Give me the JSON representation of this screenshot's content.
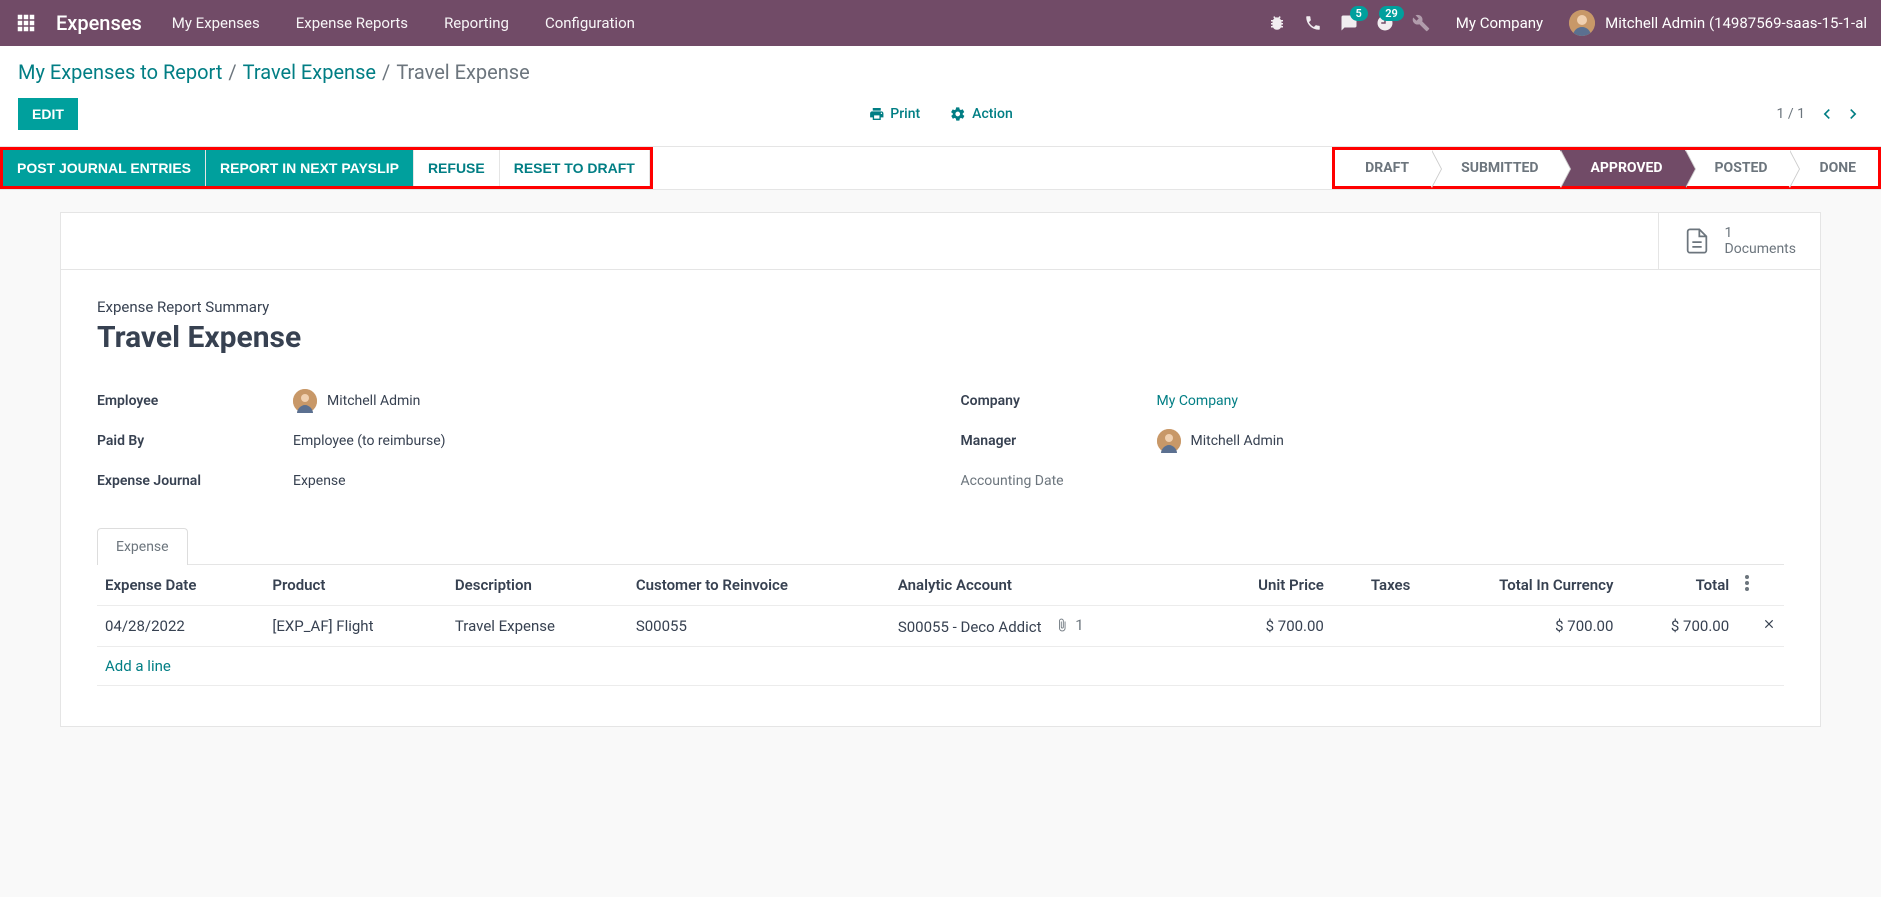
{
  "navbar": {
    "title": "Expenses",
    "menu": [
      "My Expenses",
      "Expense Reports",
      "Reporting",
      "Configuration"
    ],
    "messaging_badge": "5",
    "activities_badge": "29",
    "company": "My Company",
    "user": "Mitchell Admin (14987569-saas-15-1-al"
  },
  "breadcrumb": {
    "items": [
      "My Expenses to Report",
      "Travel Expense"
    ],
    "current": "Travel Expense"
  },
  "toolbar": {
    "edit": "EDIT",
    "print": "Print",
    "action": "Action",
    "pager": "1 / 1"
  },
  "statusbar": {
    "buttons": {
      "post_journal": "POST JOURNAL ENTRIES",
      "report_next_payslip": "REPORT IN NEXT PAYSLIP",
      "refuse": "REFUSE",
      "reset_draft": "RESET TO DRAFT"
    },
    "statuses": [
      "DRAFT",
      "SUBMITTED",
      "APPROVED",
      "POSTED",
      "DONE"
    ],
    "active_status": "APPROVED"
  },
  "stats": {
    "documents_count": "1",
    "documents_label": "Documents"
  },
  "record": {
    "section_label": "Expense Report Summary",
    "title": "Travel Expense",
    "fields": {
      "employee_label": "Employee",
      "employee_value": "Mitchell Admin",
      "paid_by_label": "Paid By",
      "paid_by_value": "Employee (to reimburse)",
      "expense_journal_label": "Expense Journal",
      "expense_journal_value": "Expense",
      "company_label": "Company",
      "company_value": "My Company",
      "manager_label": "Manager",
      "manager_value": "Mitchell Admin",
      "accounting_date_label": "Accounting Date",
      "accounting_date_value": ""
    }
  },
  "tabs": {
    "expense": "Expense"
  },
  "table": {
    "headers": {
      "date": "Expense Date",
      "product": "Product",
      "description": "Description",
      "customer": "Customer to Reinvoice",
      "analytic": "Analytic Account",
      "unit_price": "Unit Price",
      "taxes": "Taxes",
      "total_currency": "Total In Currency",
      "total": "Total"
    },
    "rows": [
      {
        "date": "04/28/2022",
        "product": "[EXP_AF] Flight",
        "description": "Travel Expense",
        "customer": "S00055",
        "analytic": "S00055 - Deco Addict",
        "attachments": "1",
        "unit_price": "$ 700.00",
        "taxes": "",
        "total_currency": "$ 700.00",
        "total": "$ 700.00"
      }
    ],
    "add_line": "Add a line"
  }
}
